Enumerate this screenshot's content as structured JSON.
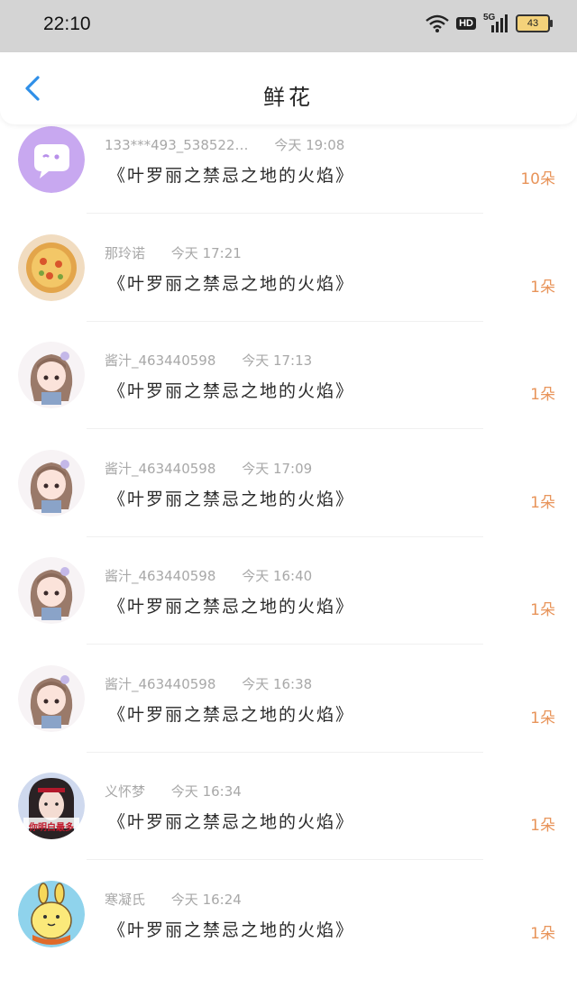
{
  "status_bar": {
    "time": "22:10",
    "network_badge": "HD",
    "signal_label": "5G",
    "battery_level": "43"
  },
  "header": {
    "title": "鲜花",
    "back_icon": "chevron-left-icon"
  },
  "colors": {
    "accent_blue": "#2f8fe8",
    "count_orange": "#e8945a",
    "status_bar_bg": "#d4d4d4"
  },
  "gifts": [
    {
      "user": "133***493_538522…",
      "time": "今天 19:08",
      "gift": "《叶罗丽之禁忌之地的火焰》",
      "count": "10朵",
      "avatar": "chat-bubble-avatar"
    },
    {
      "user": "那玲诺",
      "time": "今天 17:21",
      "gift": "《叶罗丽之禁忌之地的火焰》",
      "count": "1朵",
      "avatar": "pizza-avatar"
    },
    {
      "user": "酱汁_463440598",
      "time": "今天 17:13",
      "gift": "《叶罗丽之禁忌之地的火焰》",
      "count": "1朵",
      "avatar": "anime-girl-avatar"
    },
    {
      "user": "酱汁_463440598",
      "time": "今天 17:09",
      "gift": "《叶罗丽之禁忌之地的火焰》",
      "count": "1朵",
      "avatar": "anime-girl-avatar"
    },
    {
      "user": "酱汁_463440598",
      "time": "今天 16:40",
      "gift": "《叶罗丽之禁忌之地的火焰》",
      "count": "1朵",
      "avatar": "anime-girl-avatar"
    },
    {
      "user": "酱汁_463440598",
      "time": "今天 16:38",
      "gift": "《叶罗丽之禁忌之地的火焰》",
      "count": "1朵",
      "avatar": "anime-girl-avatar"
    },
    {
      "user": "义怀梦",
      "time": "今天 16:34",
      "gift": "《叶罗丽之禁忌之地的火焰》",
      "count": "1朵",
      "avatar": "portrait-photo-avatar",
      "avatar_caption": "你明白最多"
    },
    {
      "user": "寒凝氏",
      "time": "今天 16:24",
      "gift": "《叶罗丽之禁忌之地的火焰》",
      "count": "1朵",
      "avatar": "cartoon-bunny-avatar"
    }
  ]
}
